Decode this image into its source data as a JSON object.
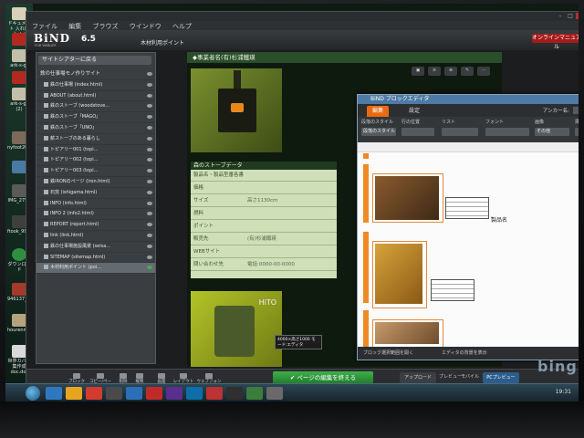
{
  "desktop": {
    "icons": [
      {
        "label": "ドキュメント 入れ替え.dot",
        "color": "#d8d0b8"
      },
      {
        "label": "",
        "color": "#b3281f"
      },
      {
        "label": "ark-s-gr",
        "color": "#c3bfa8"
      },
      {
        "label": "",
        "color": "#b3281f"
      },
      {
        "label": "ark-s-gr (2)",
        "color": "#c3bfa8"
      },
      {
        "label": "nyfoot2013001",
        "color": "#7b6a5a"
      },
      {
        "label": "",
        "color": "#4a7aa2"
      },
      {
        "label": "IMG_2750",
        "color": "#5a5a5a"
      },
      {
        "label": "ftook_9935",
        "color": "#3f3f3f"
      },
      {
        "label": "ダウンロード",
        "color": "#2f8f3f"
      },
      {
        "label": "946137_4600...",
        "color": "#a33a2a"
      },
      {
        "label": "hourenmen",
        "color": "#b7a27e"
      },
      {
        "label": "世界カバー集作成 doc.dot",
        "color": "#d9d9d9"
      }
    ]
  },
  "app": {
    "menu": [
      "ファイル",
      "編集",
      "ブラウズ",
      "ウインドウ",
      "ヘルプ"
    ],
    "logo": "BiND",
    "logo_sub": "FOR WEBLIFE",
    "version": "6.5",
    "page_title": "木材利用ポイント",
    "online_manual": "オンラインマニュアル"
  },
  "sidebar": {
    "back_label": "サイトシアターに戻る",
    "items": [
      {
        "label": "鉄の仕事場モノ作りサイト",
        "selected": false
      },
      {
        "label": "鉄の仕事場 (index.html)",
        "selected": false
      },
      {
        "label": "ABOUT (about.html)",
        "selected": false
      },
      {
        "label": "鉄のストーブ (woodstove...",
        "selected": false
      },
      {
        "label": "鉄のストーブ「MAGO」",
        "selected": false
      },
      {
        "label": "鉄のストーブ「UNO」",
        "selected": false
      },
      {
        "label": "薪ストーブのある暮らし",
        "selected": false
      },
      {
        "label": "トピアリー001 (topi...",
        "selected": false
      },
      {
        "label": "トピアリー002 (topi...",
        "selected": false
      },
      {
        "label": "トピアリー003 (topi...",
        "selected": false
      },
      {
        "label": "鉄IRONのページ (iron.html)",
        "selected": false
      },
      {
        "label": "石窯 (ishigama.html)",
        "selected": false
      },
      {
        "label": "INFO (info.html)",
        "selected": false
      },
      {
        "label": "INFO 2 (info2.html)",
        "selected": false
      },
      {
        "label": "REPORT (report.html)",
        "selected": false
      },
      {
        "label": "link (link.html)",
        "selected": false
      },
      {
        "label": "鉄の仕事場施設風景 (seisa...",
        "selected": false
      },
      {
        "label": "SITEMAP (sitemap.html)",
        "selected": false
      },
      {
        "label": "木材利用ポイント (poi...",
        "selected": true
      }
    ]
  },
  "content": {
    "breadcrumb": "◆事業者名(有)杉浦鐵瑛",
    "spec_title": "森のストーブデータ",
    "spec_rows": [
      {
        "key": "製品名・製品型番各書",
        "value": ""
      },
      {
        "key": "価格",
        "value": ""
      },
      {
        "key": "サイズ",
        "value": "高さ1130cm"
      },
      {
        "key": "燃料",
        "value": ""
      },
      {
        "key": "ポイント",
        "value": ""
      },
      {
        "key": "販売先",
        "value": "(有)杉浦鐵瑛"
      },
      {
        "key": "WEBサイト",
        "value": ""
      },
      {
        "key": "問い合わせ先",
        "value": "電話:0000-00-0000"
      }
    ],
    "tooltip": "4000×高さ1000 モード:エディタ",
    "watermark": "HiTO"
  },
  "block_editor": {
    "title": "BiND ブロックエディタ",
    "tabs": [
      {
        "label": "編集",
        "active": true
      },
      {
        "label": "設定",
        "active": false
      }
    ],
    "anchor": "アンカー名:",
    "tool_groups": [
      {
        "label": "段落のスタイル",
        "value": "段落のスタイル"
      },
      {
        "label": "行の位置",
        "value": ""
      },
      {
        "label": "リスト",
        "value": ""
      },
      {
        "label": "フォント",
        "value": ""
      },
      {
        "label": "画像",
        "value": "その他"
      },
      {
        "label": "挿入",
        "value": ""
      }
    ],
    "product_label": "製品名",
    "footer_left": "ブロック選択範囲を開く",
    "footer_right": "エディタの背景を表示"
  },
  "bottom_bar": {
    "buttons": [
      "ブロック追加",
      "コピー/ペースト",
      "削除",
      "複製",
      "画面",
      "レイアウト",
      "ウェブフォント"
    ],
    "finish": "ページの編集を終える",
    "upload": "アップロード",
    "preview": "プレビュー",
    "mobile": "モバイル",
    "pc_preview": "PCプレビュー"
  },
  "taskbar": {
    "apps": [
      "#2f78c0",
      "#e8a420",
      "#d33b2c",
      "#4a4a4a",
      "#2a6fb8",
      "#c22a2a",
      "#5a2f8f",
      "#0d6ea8",
      "#bd3232",
      "#2f2f2f",
      "#3b7d3b",
      "#6a6a6a"
    ],
    "clock": "19:31"
  },
  "watermark": "bing"
}
